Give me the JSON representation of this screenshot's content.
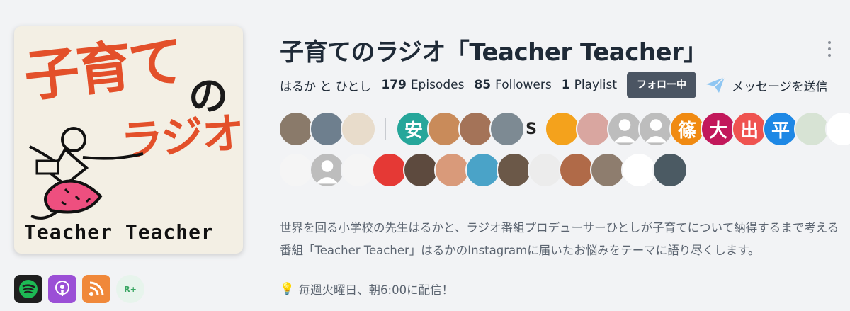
{
  "podcast": {
    "title": "子育てのラジオ「Teacher Teacher」",
    "artwork": {
      "line1": "子育て",
      "line2": "の",
      "line3": "ラジオ",
      "footer": "Teacher Teacher"
    },
    "hosts": "はるか と ひとし",
    "stats": {
      "episodes_count": "179",
      "episodes_label": "Episodes",
      "followers_count": "85",
      "followers_label": "Followers",
      "playlists_count": "1",
      "playlists_label": "Playlist"
    },
    "follow_button": "フォロー中",
    "send_message": "メッセージを送信",
    "description": "世界を回る小学校の先生はるかと、ラジオ番組プロデューサーひとしが子育てについて納得するまで考える番組「Teacher Teacher」はるかのInstagramに届いたお悩みをテーマに語り尽くします。",
    "schedule": "毎週火曜日、朝6:00に配信！"
  },
  "platforms": [
    {
      "name": "Spotify",
      "icon": "spotify-icon"
    },
    {
      "name": "Apple Podcasts",
      "icon": "apple-podcasts-icon"
    },
    {
      "name": "RSS",
      "icon": "rss-icon"
    },
    {
      "name": "R+",
      "icon": "rplus-icon"
    }
  ],
  "avatars": {
    "row1": [
      {
        "label": "",
        "color": "#8a7a6a"
      },
      {
        "label": "",
        "color": "#6e7f8e"
      },
      {
        "label": "",
        "color": "#e8dccb"
      },
      {
        "label": "安",
        "color": "#26a69a"
      },
      {
        "label": "",
        "color": "#c98b5a"
      },
      {
        "label": "",
        "color": "#a47358"
      },
      {
        "label": "",
        "color": "#7d8a93"
      },
      {
        "label": "S",
        "color": "transparent"
      },
      {
        "label": "",
        "color": "#f4a21c"
      },
      {
        "label": "",
        "color": "#d9a6a0"
      },
      {
        "label": "",
        "color": "#bdbdbd"
      },
      {
        "label": "",
        "color": "#bdbdbd"
      },
      {
        "label": "篠",
        "color": "#f08a12"
      },
      {
        "label": "大",
        "color": "#c2185b"
      },
      {
        "label": "出",
        "color": "#ef5350"
      },
      {
        "label": "平",
        "color": "#1e88e5"
      },
      {
        "label": "",
        "color": "#d7e3d4"
      },
      {
        "label": "",
        "color": "#ffffff"
      }
    ],
    "row2": [
      {
        "label": "",
        "color": "#f5f5f5"
      },
      {
        "label": "",
        "color": "#bdbdbd"
      },
      {
        "label": "",
        "color": "#f5f5f5"
      },
      {
        "label": "",
        "color": "#e53935"
      },
      {
        "label": "",
        "color": "#5d4a3e"
      },
      {
        "label": "",
        "color": "#d99a7a"
      },
      {
        "label": "",
        "color": "#4aa3c8"
      },
      {
        "label": "",
        "color": "#6b5848"
      },
      {
        "label": "",
        "color": "#ececec"
      },
      {
        "label": "",
        "color": "#b06a48"
      },
      {
        "label": "",
        "color": "#8e7d6e"
      },
      {
        "label": "",
        "color": "#ffffff"
      },
      {
        "label": "",
        "color": "#4b5a63"
      }
    ]
  },
  "colors": {
    "accent": "#e3502a",
    "follow_button_bg": "#4b5563",
    "send_icon": "#8fc6f2"
  }
}
